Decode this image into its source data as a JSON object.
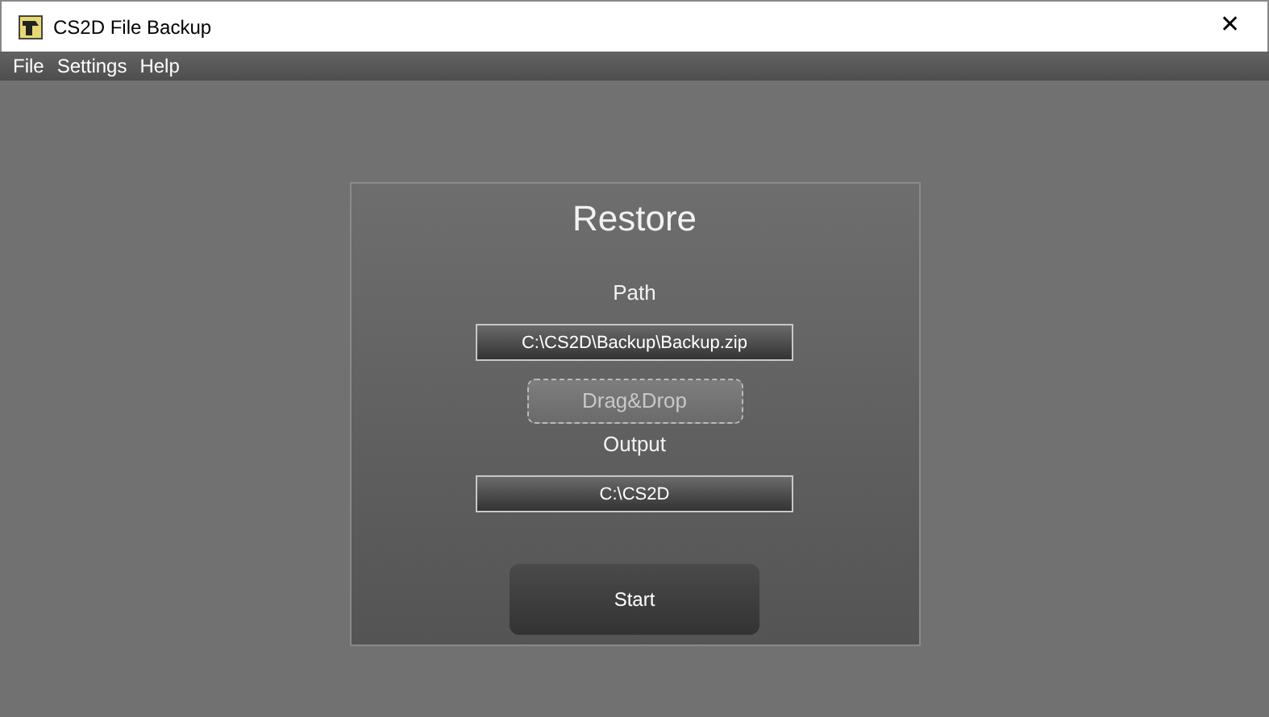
{
  "window": {
    "title": "CS2D File Backup",
    "close": "✕"
  },
  "menu": [
    "File",
    "Settings",
    "Help"
  ],
  "panel": {
    "title": "Restore",
    "path": {
      "label": "Path",
      "value": "C:\\CS2D\\Backup\\Backup.zip"
    },
    "drop_zone": "Drag&Drop",
    "output": {
      "label": "Output",
      "value": "C:\\CS2D"
    },
    "button": "Start"
  }
}
